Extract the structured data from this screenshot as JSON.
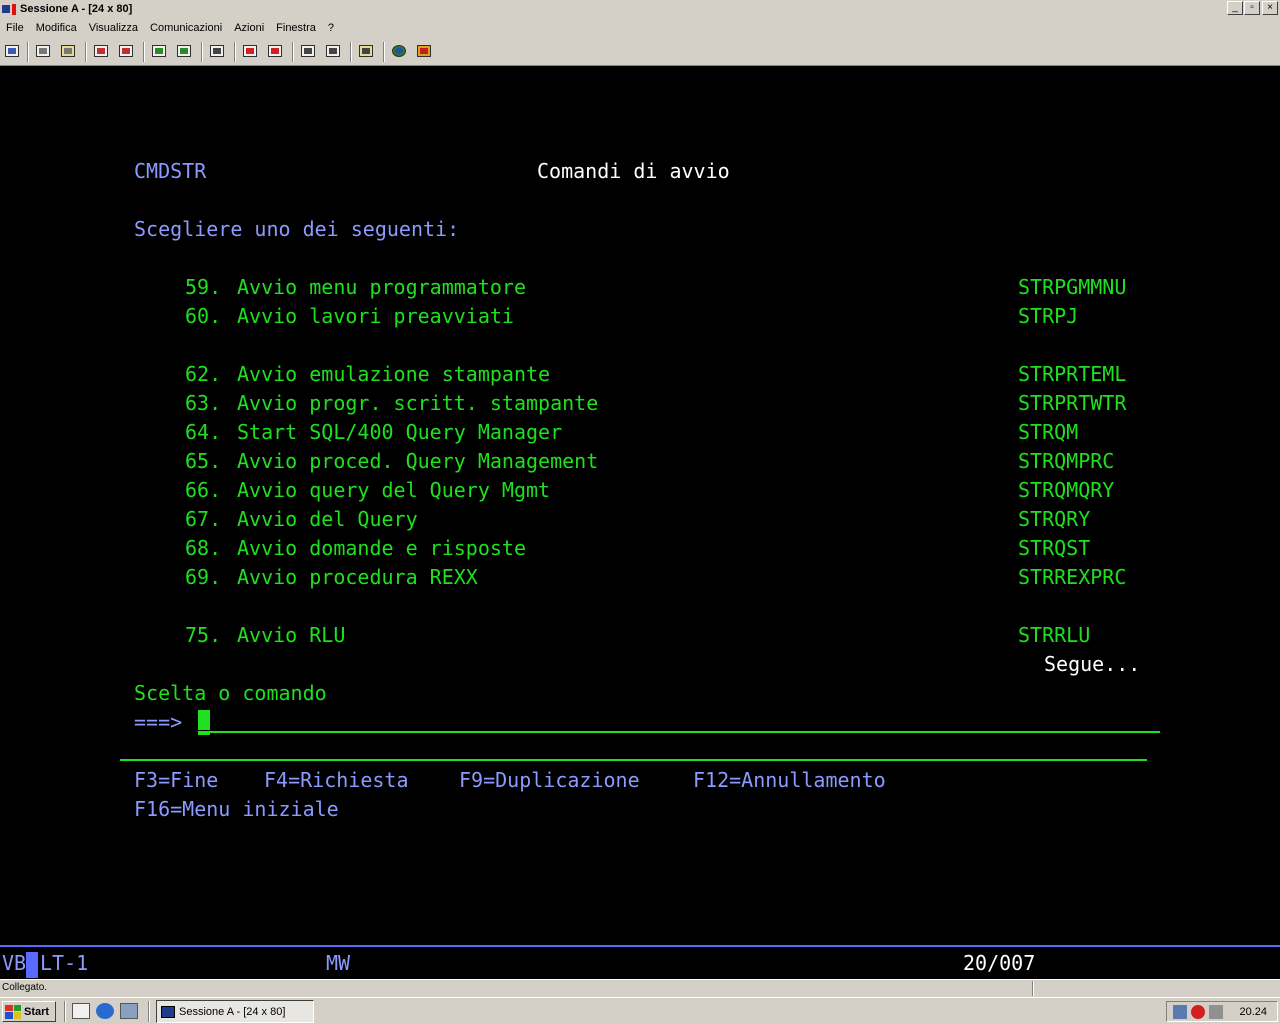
{
  "window": {
    "title": "Sessione A - [24 x 80]",
    "buttons": [
      "_",
      "▫",
      "×"
    ]
  },
  "menu": [
    "File",
    "Modifica",
    "Visualizza",
    "Comunicazioni",
    "Azioni",
    "Finestra",
    "?"
  ],
  "toolbar_icons": [
    "print-screen-icon",
    "copy-icon",
    "paste-icon",
    "send-file-icon",
    "receive-file-icon",
    "display-keyboard-icon",
    "keypad-icon",
    "macro-icon",
    "record-macro-icon",
    "stop-macro-icon",
    "play-macro-icon",
    "play-macro2-icon",
    "customize-icon",
    "support-icon",
    "help-icon"
  ],
  "screen": {
    "menu_id": "CMDSTR",
    "title": "Comandi di avvio",
    "instruction": "Scegliere uno dei seguenti:",
    "options": [
      {
        "num": "59.",
        "desc": "Avvio menu programmatore",
        "cmd": "STRPGMMNU"
      },
      {
        "num": "60.",
        "desc": "Avvio lavori preavviati",
        "cmd": "STRPJ"
      },
      {
        "num": "62.",
        "desc": "Avvio emulazione stampante",
        "cmd": "STRPRTEML"
      },
      {
        "num": "63.",
        "desc": "Avvio progr. scritt. stampante",
        "cmd": "STRPRTWTR"
      },
      {
        "num": "64.",
        "desc": "Start SQL/400 Query Manager",
        "cmd": "STRQM"
      },
      {
        "num": "65.",
        "desc": "Avvio proced. Query Management",
        "cmd": "STRQMPRC"
      },
      {
        "num": "66.",
        "desc": "Avvio query del Query Mgmt",
        "cmd": "STRQMQRY"
      },
      {
        "num": "67.",
        "desc": "Avvio del Query",
        "cmd": "STRQRY"
      },
      {
        "num": "68.",
        "desc": "Avvio domande e risposte",
        "cmd": "STRQST"
      },
      {
        "num": "69.",
        "desc": "Avvio procedura REXX",
        "cmd": "STRREXPRC"
      },
      {
        "num": "75.",
        "desc": "Avvio RLU",
        "cmd": "STRRLU"
      }
    ],
    "more": "Segue...",
    "prompt_label": "Scelta o comando",
    "prompt_arrow": "===>",
    "input_value": "",
    "fkeys_line1": [
      "F3=Fine",
      "F4=Richiesta",
      "F9=Duplicazione",
      "F12=Annullamento"
    ],
    "fkeys_line2": [
      "F16=Menu iniziale"
    ]
  },
  "oia": {
    "left_a": "VB",
    "left_b": "LT-1",
    "mid": "MW",
    "cursor_pos": "20/007"
  },
  "status": "Collegato.",
  "taskbar": {
    "start": "Start",
    "task": "Sessione A - [24 x 80]",
    "clock": "20.24"
  },
  "colors": {
    "terminal_green": "#1ee01e",
    "terminal_blue": "#8a9aff",
    "terminal_white": "#ffffff",
    "chrome": "#d4d0c8"
  }
}
